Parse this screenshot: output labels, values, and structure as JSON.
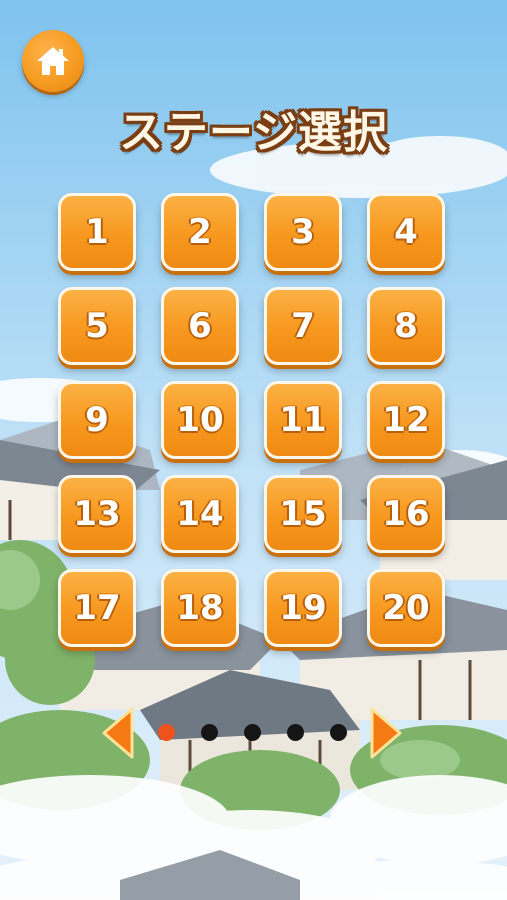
{
  "title": "ステージ選択",
  "home_icon": "home-icon",
  "stages": [
    {
      "label": "1"
    },
    {
      "label": "2"
    },
    {
      "label": "3"
    },
    {
      "label": "4"
    },
    {
      "label": "5"
    },
    {
      "label": "6"
    },
    {
      "label": "7"
    },
    {
      "label": "8"
    },
    {
      "label": "9"
    },
    {
      "label": "10"
    },
    {
      "label": "11"
    },
    {
      "label": "12"
    },
    {
      "label": "13"
    },
    {
      "label": "14"
    },
    {
      "label": "15"
    },
    {
      "label": "16"
    },
    {
      "label": "17"
    },
    {
      "label": "18"
    },
    {
      "label": "19"
    },
    {
      "label": "20"
    }
  ],
  "pager": {
    "page_count": 5,
    "current_page": 1,
    "left_icon": "arrow-left-icon",
    "right_icon": "arrow-right-icon"
  },
  "colors": {
    "button": "#f7981f",
    "button_border": "#fff7ea",
    "title_outline": "#7a3e12",
    "dot_active": "#f0531e",
    "dot_inactive": "#151515",
    "arrow": "#f57a14",
    "sky": "#a8d8f5"
  }
}
